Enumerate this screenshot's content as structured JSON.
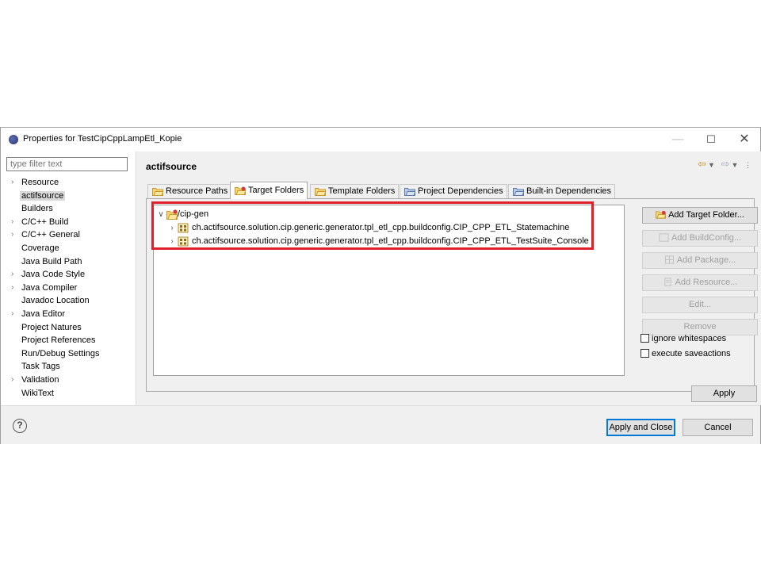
{
  "window": {
    "title": "Properties for TestCipCppLampEtl_Kopie"
  },
  "filter": {
    "placeholder": "type filter text"
  },
  "nav": {
    "items": [
      {
        "label": "Resource",
        "expandable": true
      },
      {
        "label": "actifsource",
        "expandable": false,
        "selected": true
      },
      {
        "label": "Builders",
        "expandable": false
      },
      {
        "label": "C/C++ Build",
        "expandable": true
      },
      {
        "label": "C/C++ General",
        "expandable": true
      },
      {
        "label": "Coverage",
        "expandable": false
      },
      {
        "label": "Java Build Path",
        "expandable": false
      },
      {
        "label": "Java Code Style",
        "expandable": true
      },
      {
        "label": "Java Compiler",
        "expandable": true
      },
      {
        "label": "Javadoc Location",
        "expandable": false
      },
      {
        "label": "Java Editor",
        "expandable": true
      },
      {
        "label": "Project Natures",
        "expandable": false
      },
      {
        "label": "Project References",
        "expandable": false
      },
      {
        "label": "Run/Debug Settings",
        "expandable": false
      },
      {
        "label": "Task Tags",
        "expandable": false
      },
      {
        "label": "Validation",
        "expandable": true
      },
      {
        "label": "WikiText",
        "expandable": false
      }
    ]
  },
  "page": {
    "title": "actifsource"
  },
  "tabs": [
    {
      "label": "Resource Paths",
      "active": false
    },
    {
      "label": "Target Folders",
      "active": true
    },
    {
      "label": "Template Folders",
      "active": false
    },
    {
      "label": "Project Dependencies",
      "active": false
    },
    {
      "label": "Built-in Dependencies",
      "active": false
    }
  ],
  "tree": {
    "root": "/cip-gen",
    "children": [
      "ch.actifsource.solution.cip.generic.generator.tpl_etl_cpp.buildconfig.CIP_CPP_ETL_Statemachine",
      "ch.actifsource.solution.cip.generic.generator.tpl_etl_cpp.buildconfig.CIP_CPP_ETL_TestSuite_Console"
    ]
  },
  "buttons": {
    "add_target_folder": "Add Target Folder...",
    "add_buildconfig": "Add BuildConfig...",
    "add_package": "Add Package...",
    "add_resource": "Add Resource...",
    "edit": "Edit...",
    "remove": "Remove",
    "apply": "Apply",
    "apply_and_close": "Apply and Close",
    "cancel": "Cancel"
  },
  "options": {
    "ignore_whitespaces": {
      "label": "ignore whitespaces",
      "checked": false
    },
    "execute_saveactions": {
      "label": "execute saveactions",
      "checked": false
    }
  },
  "colors": {
    "highlight": "#e0202a",
    "focus": "#0078d7"
  }
}
